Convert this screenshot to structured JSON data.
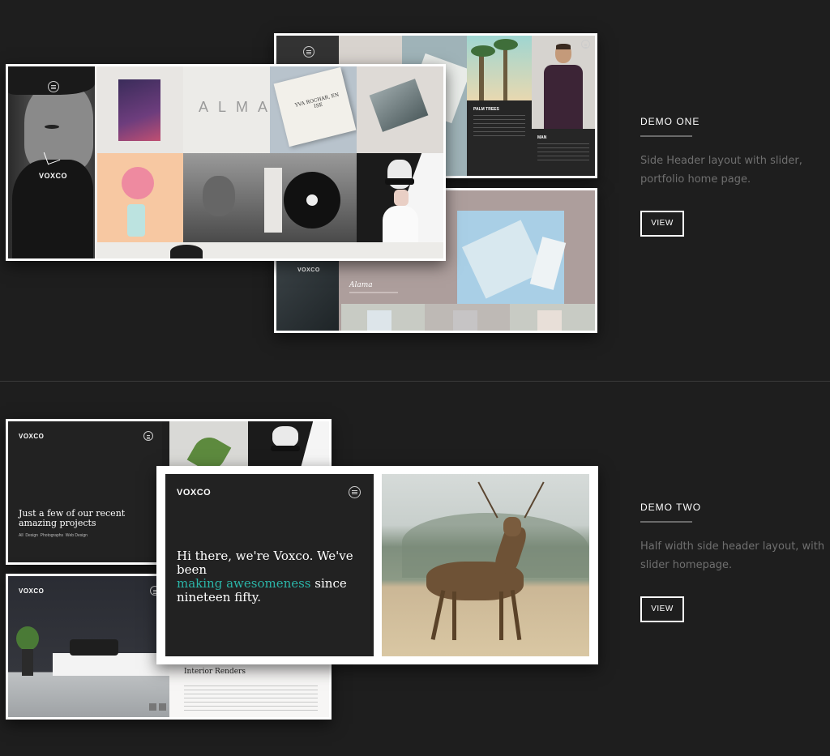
{
  "demos": [
    {
      "title": "DEMO ONE",
      "description": "Side Header layout with slider, portfolio home page.",
      "button": "VIEW"
    },
    {
      "title": "DEMO TWO",
      "description": "Half width side header layout, with slider homepage.",
      "button": "VIEW"
    }
  ],
  "demo_one_mocks": {
    "front_logo": "VOXCO",
    "alma_text": "ALMA",
    "book_title": "YVA ROCHAR, EN ISE",
    "palm_title": "PALM TREES",
    "man_title": "MAN",
    "back_logo": "VOXCO",
    "alama_title": "Alama"
  },
  "demo_two_mocks": {
    "top_logo": "VOXCO",
    "top_heading": "Just a few of our recent amazing projects",
    "top_filters": "All  Design  Photographs  Web Design",
    "bottom_logo": "VOXCO",
    "bottom_title": "Interior Renders",
    "main_logo": "VOXCO",
    "main_heading_1": "Hi there, we're Voxco. We've been",
    "main_highlight": "making awesomeness",
    "main_heading_2": " since",
    "main_heading_3": "nineteen fifty."
  },
  "colors": {
    "background": "#1e1e1e",
    "accent": "#2bb5a8",
    "muted_text": "#6f6f6f"
  }
}
